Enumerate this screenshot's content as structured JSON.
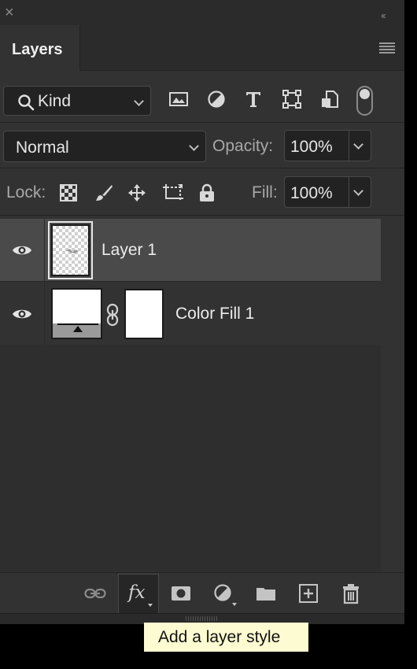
{
  "panel": {
    "tab_title": "Layers"
  },
  "filter": {
    "kind_label": "Kind"
  },
  "blending": {
    "mode": "Normal",
    "opacity_label": "Opacity:",
    "opacity_value": "100%"
  },
  "lock": {
    "lock_label": "Lock:",
    "fill_label": "Fill:",
    "fill_value": "100%"
  },
  "layers": [
    {
      "name": "Layer 1",
      "visible": true,
      "selected": true
    },
    {
      "name": "Color Fill 1",
      "visible": true,
      "selected": false
    }
  ],
  "tooltip": {
    "text": "Add a layer style"
  }
}
